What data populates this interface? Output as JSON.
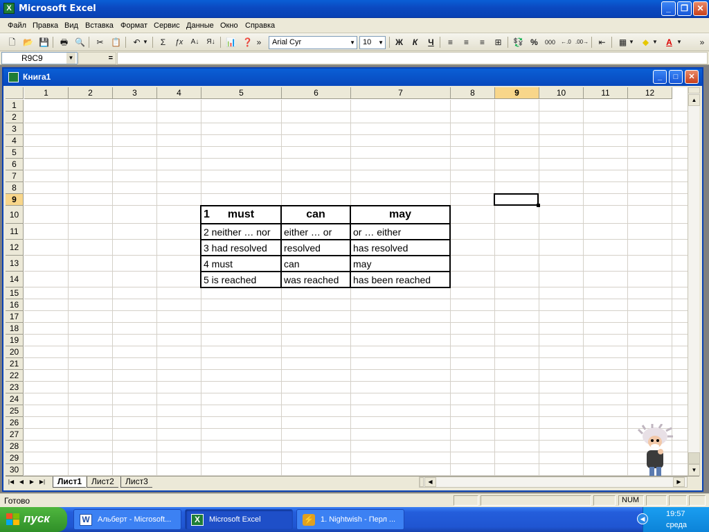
{
  "app": {
    "title": "Microsoft Excel"
  },
  "menu": [
    "Файл",
    "Правка",
    "Вид",
    "Вставка",
    "Формат",
    "Сервис",
    "Данные",
    "Окно",
    "Справка"
  ],
  "toolbar": {
    "font": "Arial Cyr",
    "size": "10",
    "bold": "Ж",
    "italic": "К",
    "underline": "Ч",
    "sum": "Σ",
    "percent": "%",
    "thousands": "000",
    "more": "»"
  },
  "formula": {
    "cell_ref": "R9C9",
    "equals": "="
  },
  "workbook": {
    "title": "Книга1"
  },
  "sheet": {
    "columns": [
      "1",
      "2",
      "3",
      "4",
      "5",
      "6",
      "7",
      "8",
      "9",
      "10",
      "11",
      "12"
    ],
    "rows": [
      "1",
      "2",
      "3",
      "4",
      "5",
      "6",
      "7",
      "8",
      "9",
      "10",
      "11",
      "12",
      "13",
      "14",
      "15",
      "16",
      "17",
      "18",
      "19",
      "20",
      "21",
      "22",
      "23",
      "24",
      "25",
      "26",
      "27",
      "28",
      "29",
      "30"
    ],
    "active_col": "9",
    "active_row": "9",
    "table": {
      "header": {
        "num": "1",
        "must": "must",
        "can": "can",
        "may": "may"
      },
      "rows": [
        [
          "2 neither … nor",
          "either … or",
          "or … either"
        ],
        [
          "3 had resolved",
          "resolved",
          "has resolved"
        ],
        [
          "4 must",
          "can",
          "may"
        ],
        [
          "5 is reached",
          "was reached",
          "has been reached"
        ]
      ]
    },
    "tabs": [
      "Лист1",
      "Лист2",
      "Лист3"
    ]
  },
  "status": {
    "text": "Готово",
    "num": "NUM"
  },
  "taskbar": {
    "start": "пуск",
    "tasks": [
      "Альберт - Microsoft...",
      "Microsoft Excel",
      "1. Nightwish - Перл ..."
    ],
    "time": "19:57",
    "day": "среда"
  }
}
